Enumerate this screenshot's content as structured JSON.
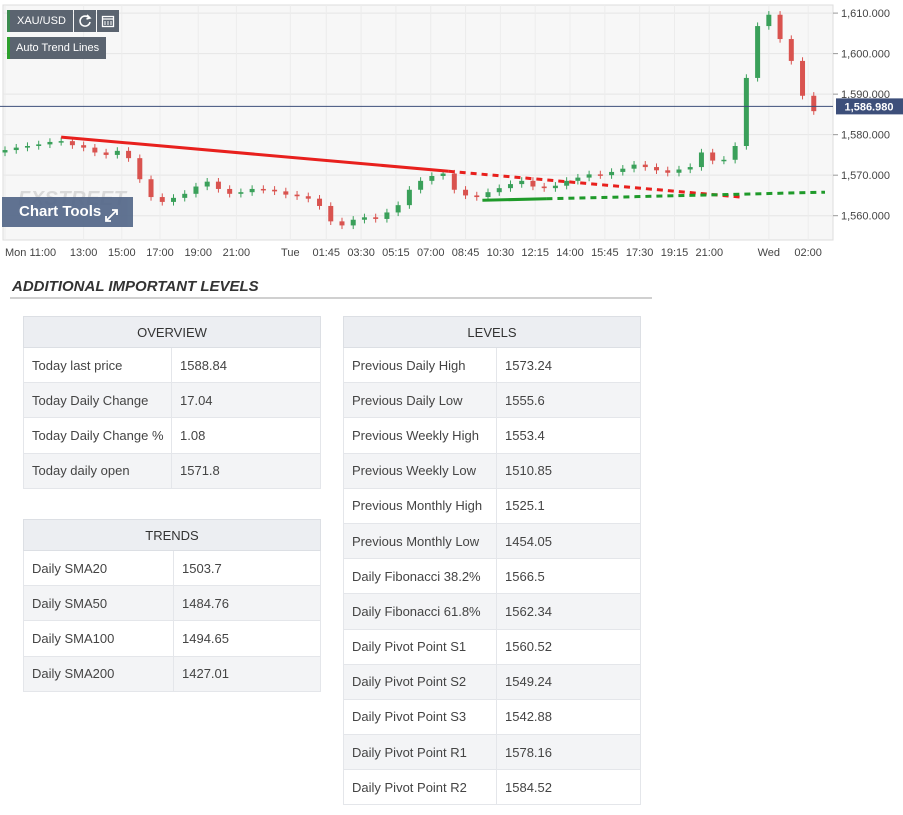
{
  "chart": {
    "symbol": "XAU/USD",
    "trend_lines_label": "Auto Trend Lines",
    "tools_label": "Chart Tools",
    "watermark": "FXSTREET",
    "current_price_label": "1,586.980",
    "icons": [
      "refresh-icon",
      "calendar-icon",
      "expand-icon"
    ],
    "colors": {
      "up": "#3aa05a",
      "down": "#d9534f",
      "resistance": "#e8201d",
      "support": "#1f9a2a",
      "price_line": "#3d4f7a"
    }
  },
  "chart_data": {
    "type": "candlestick",
    "yticks": [
      "1,560.000",
      "1,570.000",
      "1,580.000",
      "1,590.000",
      "1,600.000",
      "1,610.000"
    ],
    "ytick_values": [
      1560,
      1570,
      1580,
      1590,
      1600,
      1610
    ],
    "ylim": [
      1554,
      1612
    ],
    "xlim": [
      0,
      73
    ],
    "xticks": [
      "Mon 11:00",
      "13:00",
      "15:00",
      "17:00",
      "19:00",
      "21:00",
      "Tue",
      "01:45",
      "03:30",
      "05:15",
      "07:00",
      "08:45",
      "10:30",
      "12:15",
      "14:00",
      "15:45",
      "17:30",
      "19:15",
      "21:00",
      "Wed",
      "02:00"
    ],
    "xtick_positions": [
      0,
      7,
      10.4,
      13.8,
      17.2,
      20.6,
      25.4,
      28.6,
      31.7,
      34.8,
      37.9,
      41,
      44.1,
      47.2,
      50.3,
      53.4,
      56.5,
      59.6,
      62.7,
      68,
      71.5
    ],
    "price_line": 1586.98,
    "close_series": [
      1576.2,
      1576.8,
      1577.2,
      1577.6,
      1578.2,
      1578.4,
      1577.4,
      1576.8,
      1575.6,
      1575.0,
      1576.0,
      1574.2,
      1569.0,
      1564.6,
      1563.4,
      1564.4,
      1565.4,
      1567.2,
      1568.4,
      1566.6,
      1565.4,
      1565.8,
      1566.6,
      1566.4,
      1566.0,
      1565.2,
      1564.8,
      1564.2,
      1562.4,
      1558.6,
      1557.6,
      1559.0,
      1559.6,
      1559.2,
      1560.8,
      1562.6,
      1566.4,
      1568.6,
      1569.8,
      1570.4,
      1566.4,
      1565.0,
      1564.6,
      1565.8,
      1566.8,
      1567.8,
      1568.6,
      1567.2,
      1566.8,
      1567.4,
      1568.6,
      1569.4,
      1570.2,
      1570.0,
      1570.8,
      1571.6,
      1572.6,
      1572.0,
      1571.2,
      1570.6,
      1571.4,
      1572.0,
      1575.6,
      1573.6,
      1573.8,
      1577.2,
      1594.0,
      1606.8,
      1609.6,
      1603.6,
      1598.2,
      1589.6,
      1585.8
    ],
    "resistance_line": {
      "start": [
        5,
        1579.4
      ],
      "end": [
        65.5,
        1564.6
      ],
      "solid_until": 39.5
    },
    "support_line": {
      "start": [
        42.5,
        1563.8
      ],
      "end": [
        73,
        1565.8
      ],
      "solid_until": 48.2
    }
  },
  "section_title": "ADDITIONAL IMPORTANT LEVELS",
  "overview": {
    "header": "OVERVIEW",
    "rows": [
      {
        "label": "Today last price",
        "value": "1588.84"
      },
      {
        "label": "Today Daily Change",
        "value": "17.04"
      },
      {
        "label": "Today Daily Change %",
        "value": "1.08"
      },
      {
        "label": "Today daily open",
        "value": "1571.8"
      }
    ]
  },
  "trends": {
    "header": "TRENDS",
    "rows": [
      {
        "label": "Daily SMA20",
        "value": "1503.7"
      },
      {
        "label": "Daily SMA50",
        "value": "1484.76"
      },
      {
        "label": "Daily SMA100",
        "value": "1494.65"
      },
      {
        "label": "Daily SMA200",
        "value": "1427.01"
      }
    ]
  },
  "levels": {
    "header": "LEVELS",
    "rows": [
      {
        "label": "Previous Daily High",
        "value": "1573.24"
      },
      {
        "label": "Previous Daily Low",
        "value": "1555.6"
      },
      {
        "label": "Previous Weekly High",
        "value": "1553.4"
      },
      {
        "label": "Previous Weekly Low",
        "value": "1510.85"
      },
      {
        "label": "Previous Monthly High",
        "value": "1525.1"
      },
      {
        "label": "Previous Monthly Low",
        "value": "1454.05"
      },
      {
        "label": "Daily Fibonacci 38.2%",
        "value": "1566.5"
      },
      {
        "label": "Daily Fibonacci 61.8%",
        "value": "1562.34"
      },
      {
        "label": "Daily Pivot Point S1",
        "value": "1560.52"
      },
      {
        "label": "Daily Pivot Point S2",
        "value": "1549.24"
      },
      {
        "label": "Daily Pivot Point S3",
        "value": "1542.88"
      },
      {
        "label": "Daily Pivot Point R1",
        "value": "1578.16"
      },
      {
        "label": "Daily Pivot Point R2",
        "value": "1584.52"
      }
    ]
  }
}
